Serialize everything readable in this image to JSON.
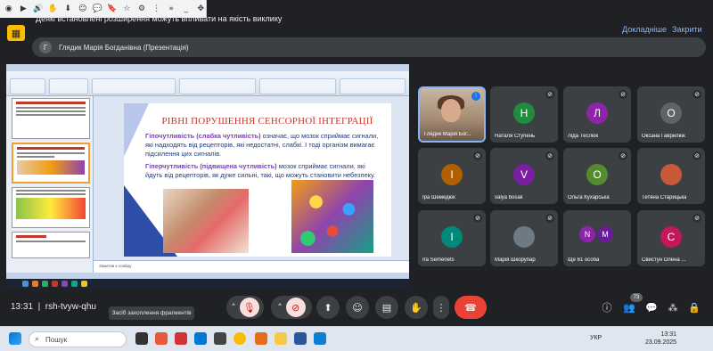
{
  "banner": {
    "message": "Деякі встановлені розширення можуть впливати на якість виклику",
    "more_label": "Докладніше",
    "close_label": "Закрити"
  },
  "presenter": {
    "initial": "Г",
    "title": "Глядик Марія Богданівна (Презентація)"
  },
  "shared_slide": {
    "title": "РІВНІ ПОРУШЕННЯ СЕНСОРНОЇ ІНТЕГРАЦІЇ",
    "p1_term": "Гіпочутливість (слабка чутливість)",
    "p1_text": " означає, що мозок сприймає сигнали, які надходять від рецепторів, які недостатні, слабкі. І тоді організм вимагає підсилення цих сигналів.",
    "p2_term": "Гіперчутливість (підвищена чутливість)",
    "p2_text": " мозок сприймає сигнали, які йдуть від рецепторів, як дуже сильні, такі, що можуть становити небезпеку.",
    "notes_placeholder": "Заметки к слайду"
  },
  "participants": [
    {
      "name": "Глядик Марія Бог...",
      "initial": "",
      "color": "#3c4043",
      "video": true
    },
    {
      "name": "Наталя Ступень",
      "initial": "Н",
      "color": "#1e8e3e"
    },
    {
      "name": "Ліда Теслюк",
      "initial": "Л",
      "color": "#8e24aa"
    },
    {
      "name": "Оксана Гаврилюк",
      "initial": "О",
      "color": "#5f6368"
    },
    {
      "name": "Іра Шемедюк",
      "initial": "І",
      "color": "#b06000"
    },
    {
      "name": "valya bosak",
      "initial": "V",
      "color": "#7b1fa2"
    },
    {
      "name": "Ольга Кухарська",
      "initial": "О",
      "color": "#558b2f"
    },
    {
      "name": "Тетяна Старицька",
      "initial": "",
      "color": "#c7593b"
    },
    {
      "name": "Ira Semenets",
      "initial": "І",
      "color": "#00897b"
    },
    {
      "name": "Марія Шкорупар",
      "initial": "",
      "color": "#6d7a86"
    },
    {
      "name": "Ще 61 особа",
      "initial": "",
      "color": "#3c4043",
      "duo": [
        "N",
        "M"
      ]
    },
    {
      "name": "Свистун Олена ...",
      "initial": "С",
      "color": "#c2185b"
    }
  ],
  "meeting": {
    "time": "13:31",
    "code": "rsh-tvyw-qhu",
    "tooltip": "Засіб захоплення фрагментів",
    "participant_count": "73"
  },
  "taskbar": {
    "search_label": "Пошук",
    "lang": "УКР",
    "time": "13:31",
    "date": "23.09.2025"
  }
}
